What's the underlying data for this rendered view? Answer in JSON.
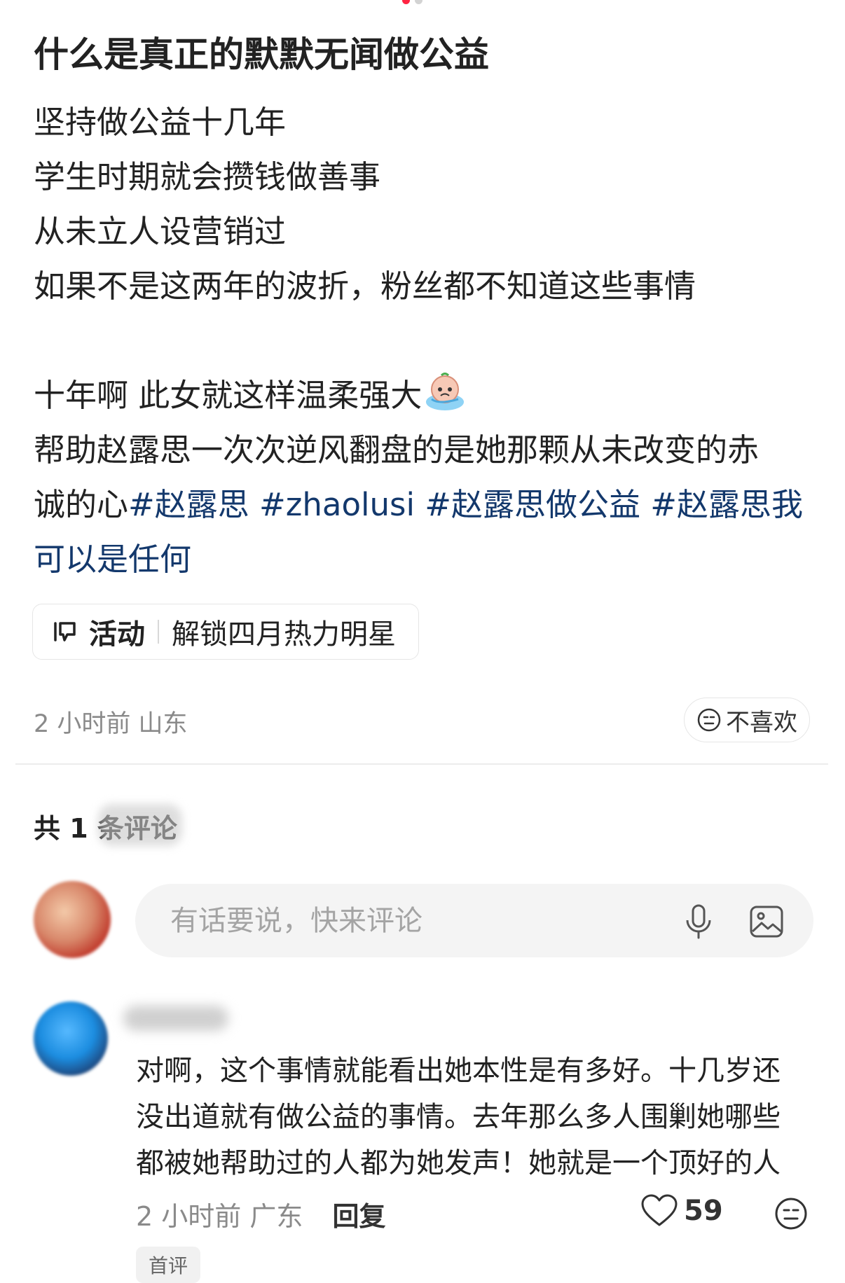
{
  "post": {
    "title": "什么是真正的默默无闻做公益",
    "lines": [
      "坚持做公益十几年",
      "学生时期就会攒钱做善事",
      "从未立人设营销过",
      "如果不是这两年的波折，粉丝都不知道这些事情"
    ],
    "para2_line1": "十年啊 此女就这样温柔强大",
    "para2_line2": "帮助赵露思一次次逆风翻盘的是她那颗从未改变的赤",
    "para2_line3_prefix": "诚的心",
    "hashtags": [
      "#赵露思",
      " #zhaolusi",
      " #赵露思做公益",
      " #赵露思我可以是任何"
    ],
    "emoji": "crying-face-emoji"
  },
  "activity": {
    "label": "活动",
    "text": "解锁四月热力明星"
  },
  "meta": {
    "time_location": "2 小时前 山东",
    "dislike_label": "不喜欢"
  },
  "comments": {
    "count_label": "共 1 条评论",
    "input_placeholder": "有话要说，快来评论",
    "items": [
      {
        "text_lines": [
          "对啊，这个事情就能看出她本性是有多好。十几岁还",
          "没出道就有做公益的事情。去年那么多人围剿她哪些",
          "都被她帮助过的人都为她发声！她就是一个顶好的人"
        ],
        "time_location": "2 小时前 广东",
        "reply_label": "回复",
        "likes": "59",
        "badge": "首评"
      }
    ]
  },
  "colors": {
    "accent": "#ff2442",
    "hashtag": "#13386c",
    "muted": "#8a8a8a"
  }
}
